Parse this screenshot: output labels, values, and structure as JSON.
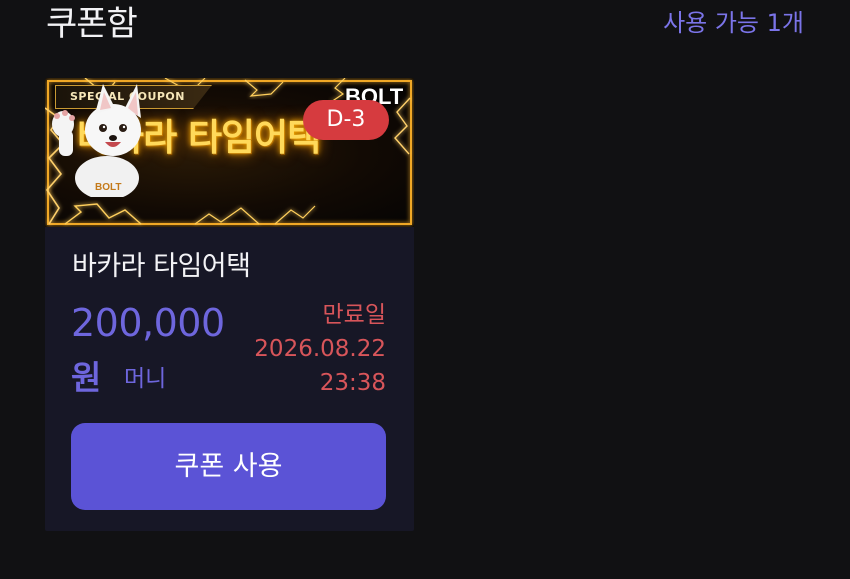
{
  "header": {
    "title": "쿠폰함",
    "available_count": "사용 가능 1개"
  },
  "coupon": {
    "banner": {
      "ribbon": "SPECIAL COUPON",
      "title": "바카라 타임어택",
      "logo": "BOLT",
      "mascot": "white-dog-mascot-icon"
    },
    "dday": "D-3",
    "name": "바카라 타임어택",
    "amount": "200,000",
    "currency": "원",
    "money_type": "머니",
    "expiry_label": "만료일",
    "expiry_date": "2026.08.22",
    "expiry_time": "23:38",
    "use_button_label": "쿠폰 사용"
  },
  "colors": {
    "background": "#111113",
    "card": "#171726",
    "accent": "#5b53d6",
    "amount": "#6e66dd",
    "expiry": "#d8555a",
    "badge": "#d63b3f"
  }
}
